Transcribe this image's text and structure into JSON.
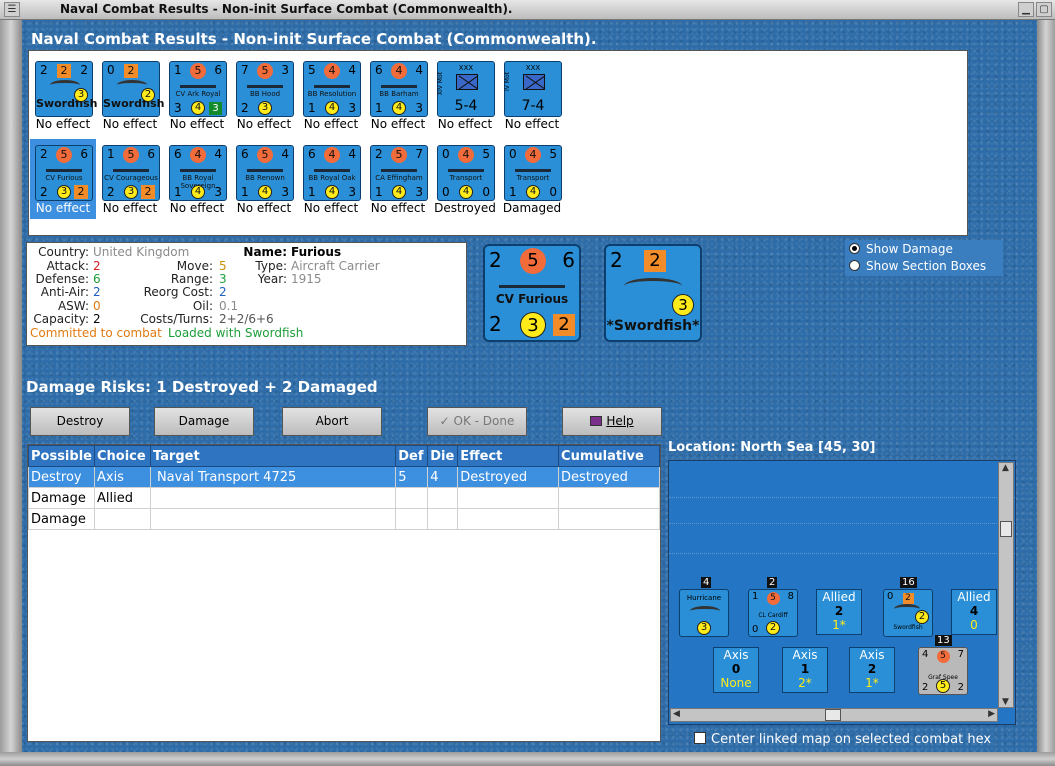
{
  "window": {
    "title": "Naval Combat Results - Non-init Surface Combat (Commonwealth)."
  },
  "heading": "Naval Combat Results - Non-init Surface Combat (Commonwealth).",
  "units": [
    {
      "kind": "air",
      "atk": "2",
      "mid": "2",
      "midShape": "square",
      "def": "2",
      "name": "Swordfish",
      "bl": "",
      "bm": "3",
      "br": "",
      "effect": "No effect"
    },
    {
      "kind": "air",
      "atk": "0",
      "mid": "2",
      "midShape": "square",
      "def": "",
      "name": "Swordfish",
      "bl": "",
      "bm": "2",
      "br": "",
      "effect": "No effect"
    },
    {
      "kind": "ship",
      "atk": "1",
      "mid": "5",
      "midShape": "circle",
      "def": "6",
      "name": "CV Ark Royal",
      "bl": "3",
      "bm": "4",
      "br": "3",
      "brShape": "green",
      "effect": "No effect"
    },
    {
      "kind": "ship",
      "atk": "7",
      "mid": "5",
      "midShape": "circle",
      "def": "3",
      "name": "BB Hood",
      "bl": "2",
      "bm": "3",
      "br": "",
      "effect": "No effect"
    },
    {
      "kind": "ship",
      "atk": "5",
      "mid": "4",
      "midShape": "circle",
      "def": "4",
      "name": "BB Resolution",
      "bl": "1",
      "bm": "4",
      "br": "3",
      "effect": "No effect"
    },
    {
      "kind": "ship",
      "atk": "6",
      "mid": "4",
      "midShape": "circle",
      "def": "4",
      "name": "BB Barham",
      "bl": "1",
      "bm": "4",
      "br": "3",
      "effect": "No effect"
    },
    {
      "kind": "army",
      "atk": "",
      "mid": "XXX",
      "midShape": "text",
      "def": "",
      "name": "XIV Mot",
      "bl": "",
      "bm": "5-4",
      "br": "",
      "effect": "No effect"
    },
    {
      "kind": "army",
      "atk": "",
      "mid": "XXX",
      "midShape": "text",
      "def": "",
      "name": "IV Mot",
      "bl": "",
      "bm": "7-4",
      "br": "",
      "effect": "No effect"
    },
    {
      "kind": "ship",
      "atk": "2",
      "mid": "5",
      "midShape": "circle",
      "def": "6",
      "name": "CV Furious",
      "bl": "2",
      "bm": "3",
      "br": "2",
      "brShape": "square",
      "effect": "No effect",
      "selected": true
    },
    {
      "kind": "ship",
      "atk": "1",
      "mid": "5",
      "midShape": "circle",
      "def": "6",
      "name": "CV Courageous",
      "bl": "2",
      "bm": "3",
      "br": "2",
      "brShape": "square",
      "effect": "No effect"
    },
    {
      "kind": "ship",
      "atk": "6",
      "mid": "4",
      "midShape": "circle",
      "def": "4",
      "name": "BB Royal Sovereign",
      "bl": "1",
      "bm": "4",
      "br": "3",
      "effect": "No effect"
    },
    {
      "kind": "ship",
      "atk": "6",
      "mid": "5",
      "midShape": "circle",
      "def": "4",
      "name": "BB Renown",
      "bl": "1",
      "bm": "4",
      "br": "3",
      "effect": "No effect"
    },
    {
      "kind": "ship",
      "atk": "6",
      "mid": "4",
      "midShape": "circle",
      "def": "4",
      "name": "BB Royal Oak",
      "bl": "1",
      "bm": "4",
      "br": "3",
      "effect": "No effect"
    },
    {
      "kind": "ship",
      "atk": "2",
      "mid": "5",
      "midShape": "circle",
      "def": "7",
      "name": "CA Effingham",
      "bl": "1",
      "bm": "4",
      "br": "3",
      "effect": "No effect"
    },
    {
      "kind": "ship",
      "atk": "0",
      "mid": "4",
      "midShape": "circle",
      "def": "5",
      "name": "Transport",
      "bl": "0",
      "bm": "4",
      "br": "0",
      "effect": "Destroyed"
    },
    {
      "kind": "ship",
      "atk": "0",
      "mid": "4",
      "midShape": "circle",
      "def": "5",
      "name": "Transport",
      "bl": "1",
      "bm": "4",
      "br": "0",
      "effect": "Damaged"
    }
  ],
  "detail": {
    "country_label": "Country:",
    "country": "United Kingdom",
    "attack_label": "Attack:",
    "attack": "2",
    "defense_label": "Defense:",
    "defense": "6",
    "antiair_label": "Anti-Air:",
    "antiair": "2",
    "asw_label": "ASW:",
    "asw": "0",
    "capacity_label": "Capacity:",
    "capacity": "2",
    "name_label": "Name:",
    "name": "Furious",
    "type_label": "Type:",
    "type": "Aircraft Carrier",
    "year_label": "Year:",
    "year": "1915",
    "move_label": "Move:",
    "move": "5",
    "range_label": "Range:",
    "range": "3",
    "reorg_label": "Reorg Cost:",
    "reorg": "2",
    "oil_label": "Oil:",
    "oil": "0.1",
    "costs_label": "Costs/Turns:",
    "costs": "2+2/6+6",
    "committed": "Committed to combat",
    "loaded": "Loaded with Swordfish"
  },
  "big_ship": {
    "tl": "2",
    "tc": "5",
    "tr": "6",
    "name": "CV Furious",
    "bl": "2",
    "bc": "3",
    "br": "2"
  },
  "big_air": {
    "tl": "2",
    "tc": "2",
    "bc": "3",
    "name": "*Swordfish*"
  },
  "options": {
    "show_damage": "Show Damage",
    "show_sections": "Show Section Boxes"
  },
  "risks": "Damage Risks:  1 Destroyed + 2 Damaged",
  "buttons": {
    "destroy": "Destroy",
    "damage": "Damage",
    "abort": "Abort",
    "ok": "OK - Done",
    "help": "Help"
  },
  "table": {
    "headers": [
      "Possible",
      "Choice",
      "Target",
      "Def",
      "Die",
      "Effect",
      "Cumulative"
    ],
    "rows": [
      [
        "Destroy",
        "Axis",
        "Naval Transport 4725",
        "5",
        "4",
        "Destroyed",
        "Destroyed"
      ],
      [
        "Damage",
        "Allied",
        "",
        "",
        "",
        "",
        ""
      ],
      [
        "Damage",
        "",
        "",
        "",
        "",
        "",
        ""
      ]
    ]
  },
  "location": "Location:  North Sea [45, 30]",
  "map": {
    "hurricane": {
      "stack": "4",
      "name": "Hurricane",
      "bottom": "3"
    },
    "cardiff": {
      "stack": "2",
      "a": "1",
      "m": "5",
      "d": "8",
      "name": "CL Cardiff",
      "bl": "0",
      "b": "2"
    },
    "allied1": {
      "title": "Allied",
      "v": "2",
      "s": "1*"
    },
    "swordfish": {
      "stack": "16",
      "a": "0",
      "m": "2",
      "name": "Swordfish",
      "b": "2"
    },
    "allied2": {
      "title": "Allied",
      "v": "4",
      "s": "0"
    },
    "axis1": {
      "title": "Axis",
      "v": "0",
      "s": "None"
    },
    "axis2": {
      "title": "Axis",
      "v": "1",
      "s": "2*"
    },
    "axis3": {
      "title": "Axis",
      "v": "2",
      "s": "1*"
    },
    "spee": {
      "stack": "13",
      "a": "4",
      "m": "5",
      "d": "7",
      "name": "Graf Spee",
      "bl": "2",
      "b": "5",
      "br": "2"
    }
  },
  "center_checkbox": "Center linked map on selected combat hex",
  "colors": {
    "accent": "#3d8fe0",
    "counter": "#2a8fd6",
    "attack": "#d62020",
    "defense": "#1e9e3a",
    "orange": "#f26b3a",
    "yellow": "#ffeb1a"
  }
}
